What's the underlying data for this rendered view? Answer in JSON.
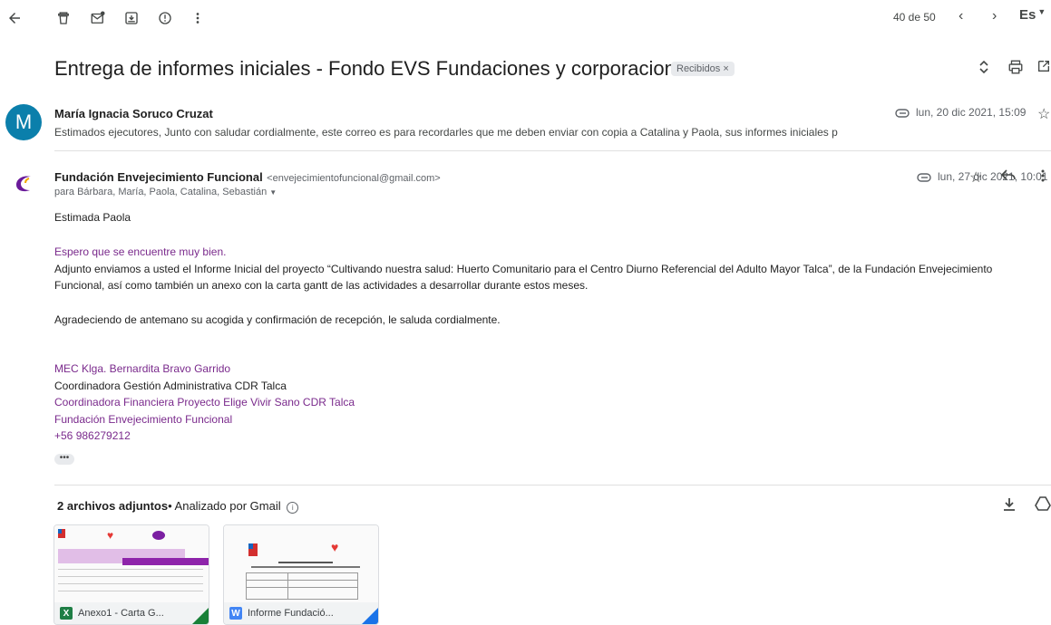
{
  "toolbar": {
    "counter": "40 de 50",
    "lang": "Es"
  },
  "subject": "Entrega de informes iniciales - Fondo EVS Fundaciones y corporaciones",
  "label_chip": "Recibidos ×",
  "message1": {
    "avatar_letter": "M",
    "sender": "María Ignacia Soruco Cruzat",
    "date": "lun, 20 dic 2021, 15:09",
    "snippet": "Estimados ejecutores, Junto con saludar cordialmente, este correo es para recordarles que me deben enviar con copia a Catalina y Paola, sus informes iniciales p"
  },
  "message2": {
    "sender": "Fundación Envejecimiento Funcional",
    "email": "<envejecimientofuncional@gmail.com>",
    "to": "para Bárbara, María, Paola, Catalina, Sebastián",
    "date": "lun, 27 dic 2021, 10:01",
    "greeting": "Estimada Paola",
    "line1": "Espero que se encuentre muy bien.",
    "line2": "Adjunto enviamos a usted el Informe Inicial del proyecto “Cultivando nuestra salud: Huerto Comunitario para el Centro Diurno Referencial del Adulto Mayor Talca”, de la Fundación Envejecimiento",
    "line3": "Funcional, así como también un anexo con la carta gantt de las actividades a desarrollar durante estos meses.",
    "line4": "Agradeciendo de antemano su acogida y confirmación de recepción, le saluda cordialmente.",
    "sig1": "MEC Klga. Bernardita Bravo Garrido",
    "sig2": "Coordinadora Gestión Administrativa CDR Talca",
    "sig3": "Coordinadora Financiera Proyecto Elige Vivir Sano CDR Talca",
    "sig4": "Fundación Envejecimiento Funcional",
    "sig5": "+56 986279212",
    "dots": "•••"
  },
  "attachments": {
    "title": "2 archivos adjuntos",
    "scanned": "• Analizado por Gmail",
    "items": [
      {
        "name": "Anexo1 - Carta G...",
        "type_letter": "X",
        "color": "#1e7e45",
        "corner": "#188038"
      },
      {
        "name": "Informe Fundació...",
        "type_letter": "W",
        "color": "#4285f4",
        "corner": "#1a73e8"
      }
    ]
  }
}
